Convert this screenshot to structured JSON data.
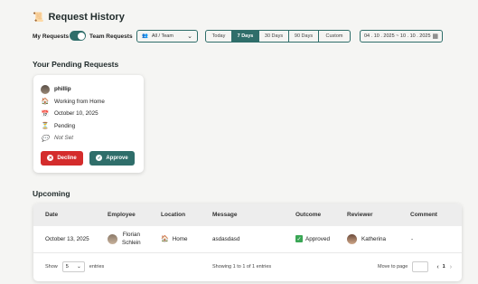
{
  "header": {
    "title": "Request History",
    "title_icon": "📜"
  },
  "filters": {
    "my_requests_label": "My Requests",
    "team_requests_label": "Team Requests",
    "team_select_value": "All / Team",
    "ranges": [
      "Today",
      "7 Days",
      "30 Days",
      "90 Days",
      "Custom"
    ],
    "active_range": "7 Days",
    "date_range": "04 . 10 . 2025 ~ 10 . 10 . 2025"
  },
  "pending": {
    "section_title": "Your Pending Requests",
    "card": {
      "name": "phillip",
      "type": "Working from Home",
      "date": "October 10, 2025",
      "status": "Pending",
      "note": "Not Set",
      "decline_label": "Decline",
      "approve_label": "Approve"
    }
  },
  "upcoming": {
    "section_title": "Upcoming",
    "columns": [
      "Date",
      "Employee",
      "Location",
      "Message",
      "Outcome",
      "Reviewer",
      "Comment"
    ],
    "rows": [
      {
        "date": "October 13, 2025",
        "employee_first": "Florian",
        "employee_last": "Schlein",
        "location": "Home",
        "message": "asdasdasd",
        "outcome": "Approved",
        "reviewer": "Katherina",
        "comment": "-"
      }
    ],
    "footer": {
      "show_label": "Show",
      "page_size": "5",
      "entries_label": "entries",
      "showing_text": "Showing 1 to 1 of 1 entries",
      "move_label": "Move to page",
      "current_page": "1"
    }
  },
  "colors": {
    "accent": "#2f6e6a",
    "decline": "#d42c2c",
    "approved": "#3aa655"
  }
}
